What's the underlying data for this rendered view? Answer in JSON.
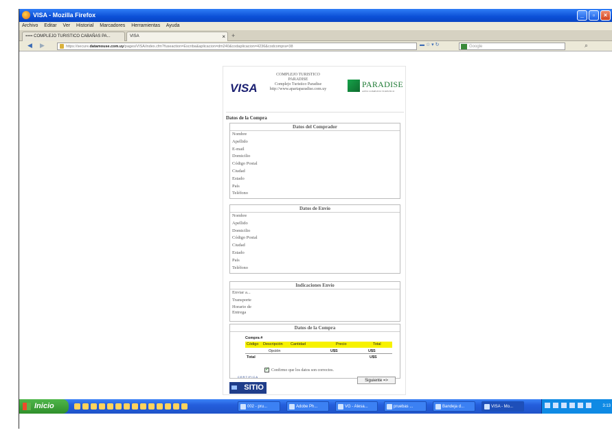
{
  "window": {
    "title": "VISA - Mozilla Firefox"
  },
  "menu": [
    "Archivo",
    "Editar",
    "Ver",
    "Historial",
    "Marcadores",
    "Herramientas",
    "Ayuda"
  ],
  "tabs": [
    {
      "label": "=== COMPLEJO TURISTICO CABAÑAS PA..."
    },
    {
      "label": "VISA"
    }
  ],
  "nav": {
    "url_prefix": "https://secure.",
    "url_domain": "datamouse.com.uy",
    "url_rest": "/pages/VISA/index.cfm?fuseaction=Escriba&aplicacion=dm240&codaplicacion=4236&codcompra=38",
    "search_placeholder": "Google"
  },
  "page": {
    "brand_visa": "VISA",
    "header_lines": [
      "COMPLEJO TURISTICO",
      "PARADISE",
      "Complejo Turistico Paradise",
      "http://www.apartaparadise.com.uy"
    ],
    "paradise_name": "PARADISE",
    "paradise_sub": "APTO COMPLEJO TURISTICO",
    "section_title": "Datos de la Compra",
    "buyer": {
      "header": "Datos del Comprador",
      "fields": [
        "Nombre",
        "Apellido",
        "E-mail",
        "Domicilio",
        "Código Postal",
        "Ciudad",
        "Estado",
        "País",
        "Teléfono"
      ]
    },
    "shipping": {
      "header": "Datos de Envío",
      "fields": [
        "Nombre",
        "Apellido",
        "Domicilio",
        "Código Postal",
        "Ciudad",
        "Estado",
        "País",
        "Teléfono"
      ]
    },
    "instructions": {
      "header": "Indicaciones Envío",
      "fields": [
        "Enviar a...",
        "Transporte",
        "Horario de",
        "Entrega"
      ]
    },
    "purchase": {
      "header": "Datos de la Compra",
      "compra_label": "Compra #",
      "columns": [
        "Código",
        "Descripción",
        "Cantidad",
        "Precio",
        "Total"
      ],
      "option_label": "Opción",
      "option_currency_1": "U$S",
      "option_currency_2": "U$S",
      "total_label": "Total",
      "total_currency": "U$S"
    },
    "confirm_text": "Confirmo que los datos son correctos.",
    "next_button": "Siguiente =>",
    "cert_top": "CERTIFICA",
    "cert_name": "SITIO"
  },
  "taskbar": {
    "start": "Inicio",
    "buttons": [
      "002 - pru...",
      "Adobe Ph...",
      "VG - Alesa...",
      "pruebas ...",
      "Bandeja d...",
      "VISA - Mo..."
    ],
    "clock": "3:13"
  }
}
